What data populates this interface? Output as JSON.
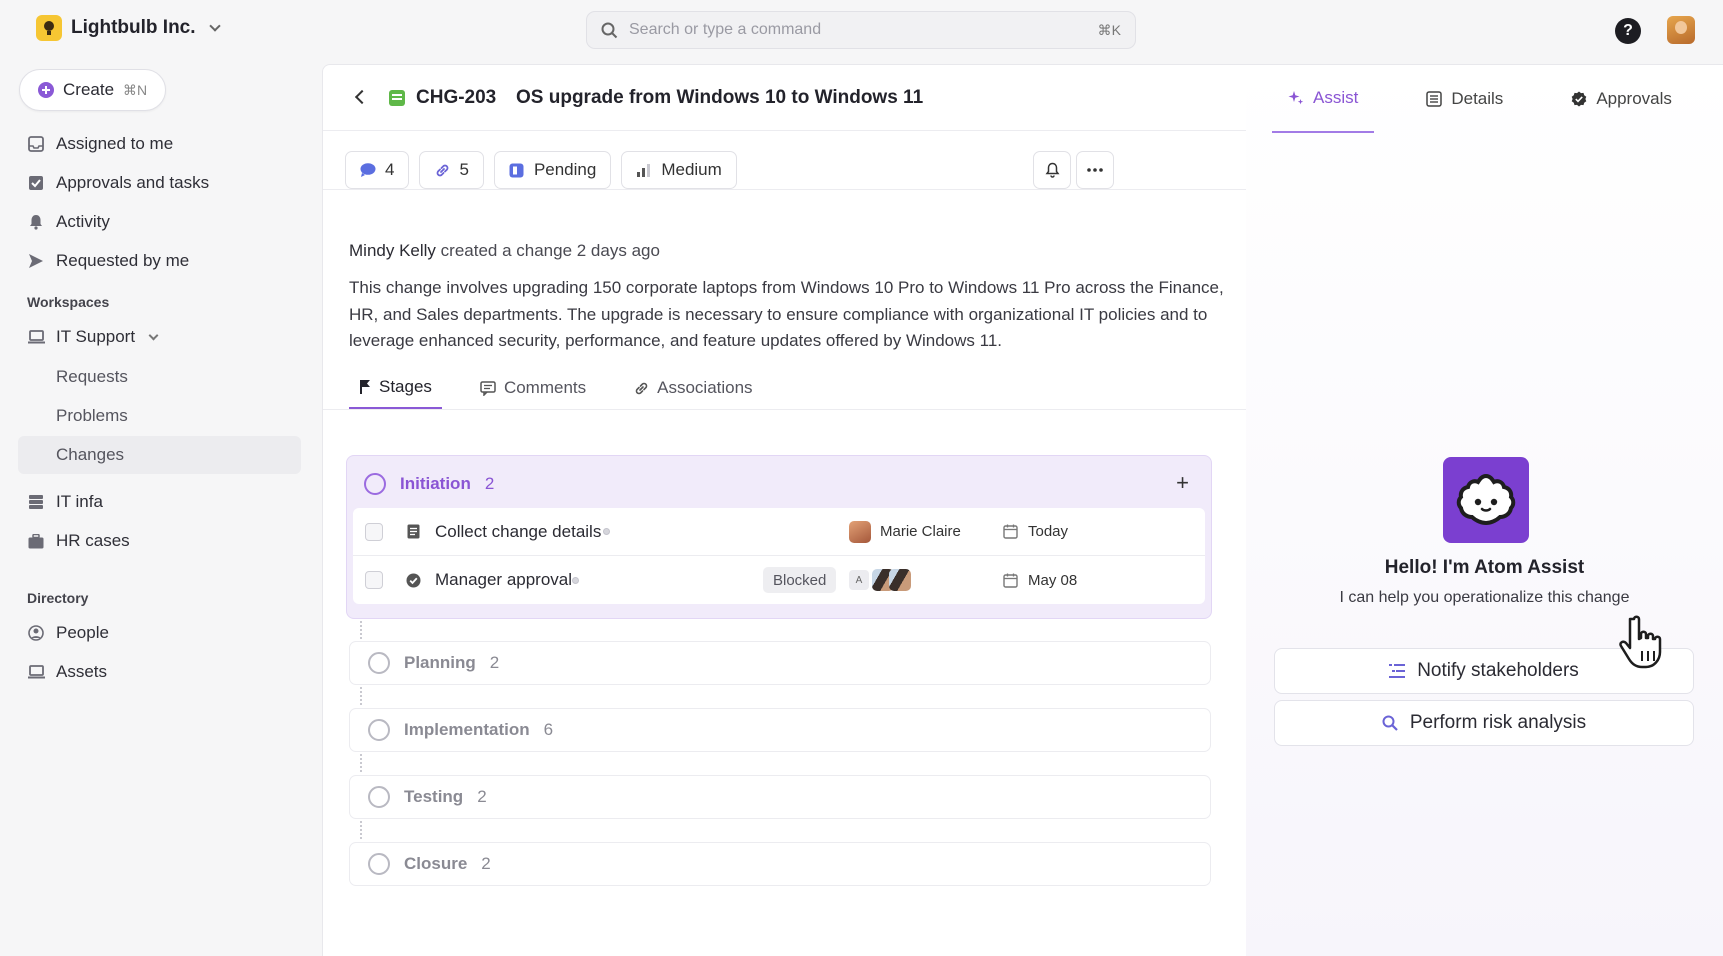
{
  "org": {
    "name": "Lightbulb Inc."
  },
  "search": {
    "placeholder": "Search or type a command",
    "shortcut": "⌘K"
  },
  "sidebar": {
    "create_label": "Create",
    "create_shortcut": "⌘N",
    "items": [
      {
        "label": "Assigned to me",
        "icon": "inbox-icon"
      },
      {
        "label": "Approvals and tasks",
        "icon": "checkbox-icon"
      },
      {
        "label": "Activity",
        "icon": "bell-icon"
      },
      {
        "label": "Requested by me",
        "icon": "send-icon"
      }
    ],
    "workspaces_heading": "Workspaces",
    "workspace": {
      "label": "IT Support",
      "icon": "laptop-icon"
    },
    "workspace_children": [
      "Requests",
      "Problems",
      "Changes"
    ],
    "active_child": "Changes",
    "more_items": [
      {
        "label": "IT infa",
        "icon": "server-icon"
      },
      {
        "label": "HR cases",
        "icon": "briefcase-icon"
      }
    ],
    "directory_heading": "Directory",
    "directory_items": [
      {
        "label": "People",
        "icon": "person-icon"
      },
      {
        "label": "Assets",
        "icon": "laptop-icon"
      }
    ]
  },
  "change": {
    "id": "CHG-203",
    "title": "OS upgrade from Windows 10 to Windows 11",
    "chips": {
      "comments": "4",
      "links": "5",
      "status": "Pending",
      "priority": "Medium"
    },
    "author": "Mindy Kelly",
    "author_action": "created a change 2 days ago",
    "description": "This change involves upgrading 150 corporate laptops from Windows 10 Pro to Windows 11 Pro across the Finance, HR, and Sales departments. The upgrade is necessary to ensure compliance with organizational IT policies and to leverage enhanced security, performance, and feature updates offered by Windows 11."
  },
  "tabs": [
    "Stages",
    "Comments",
    "Associations"
  ],
  "stages": {
    "initiation": {
      "name": "Initiation",
      "count": "2",
      "tasks": [
        {
          "name": "Collect change details",
          "assignee": "Marie Claire",
          "due": "Today"
        },
        {
          "name": "Manager approval",
          "badge": "Blocked",
          "assignee_initial": "A",
          "due": "May 08"
        }
      ]
    },
    "others": [
      {
        "name": "Planning",
        "count": "2"
      },
      {
        "name": "Implementation",
        "count": "6"
      },
      {
        "name": "Testing",
        "count": "2"
      },
      {
        "name": "Closure",
        "count": "2"
      }
    ]
  },
  "right_tabs": [
    "Assist",
    "Details",
    "Approvals"
  ],
  "assist": {
    "title": "Hello! I'm Atom Assist",
    "subtitle": "I can help you operationalize this change",
    "actions": [
      "Notify stakeholders",
      "Perform risk analysis"
    ]
  },
  "colors": {
    "accent": "#8a55d4",
    "brand_logo": "#f6c633",
    "atom": "#7b3fd0",
    "change_icon": "#5fb848"
  }
}
